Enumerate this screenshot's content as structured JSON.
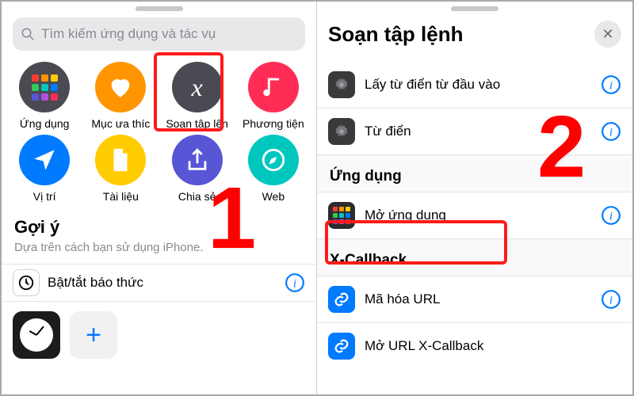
{
  "left": {
    "search_placeholder": "Tìm kiếm ứng dụng và tác vụ",
    "categories": [
      {
        "label": "Ứng dụng",
        "icon": "apps-grid-icon"
      },
      {
        "label": "Mục ưa thíc",
        "icon": "heart-icon"
      },
      {
        "label": "Soạn tập lện",
        "icon": "script-x-icon"
      },
      {
        "label": "Phương tiện",
        "icon": "music-note-icon"
      },
      {
        "label": "Vị trí",
        "icon": "location-arrow-icon"
      },
      {
        "label": "Tài liệu",
        "icon": "document-icon"
      },
      {
        "label": "Chia sẻ",
        "icon": "share-icon"
      },
      {
        "label": "Web",
        "icon": "compass-icon"
      }
    ],
    "suggestions_header": "Gợi ý",
    "suggestions_sub": "Dựa trên cách bạn sử dụng iPhone.",
    "suggestion_item": "Bật/tắt báo thức"
  },
  "right": {
    "title": "Soạn tập lệnh",
    "rows_top": [
      {
        "label": "Lấy từ điển từ đầu vào",
        "icon": "gear-icon"
      },
      {
        "label": "Từ điển",
        "icon": "gear-icon"
      }
    ],
    "section_app": "Ứng dụng",
    "row_open_app": "Mở ứng dụng",
    "section_xcb": "X-Callback",
    "rows_xcb": [
      {
        "label": "Mã hóa URL",
        "icon": "link-icon"
      },
      {
        "label": "Mở URL X-Callback",
        "icon": "link-icon"
      }
    ]
  },
  "annotations": {
    "step1": "1",
    "step2": "2",
    "highlighted_left": "Soạn tập lệnh category",
    "highlighted_right": "Mở ứng dụng row"
  },
  "colors": {
    "accent_blue": "#007aff",
    "annotation_red": "#ff1a1a"
  }
}
